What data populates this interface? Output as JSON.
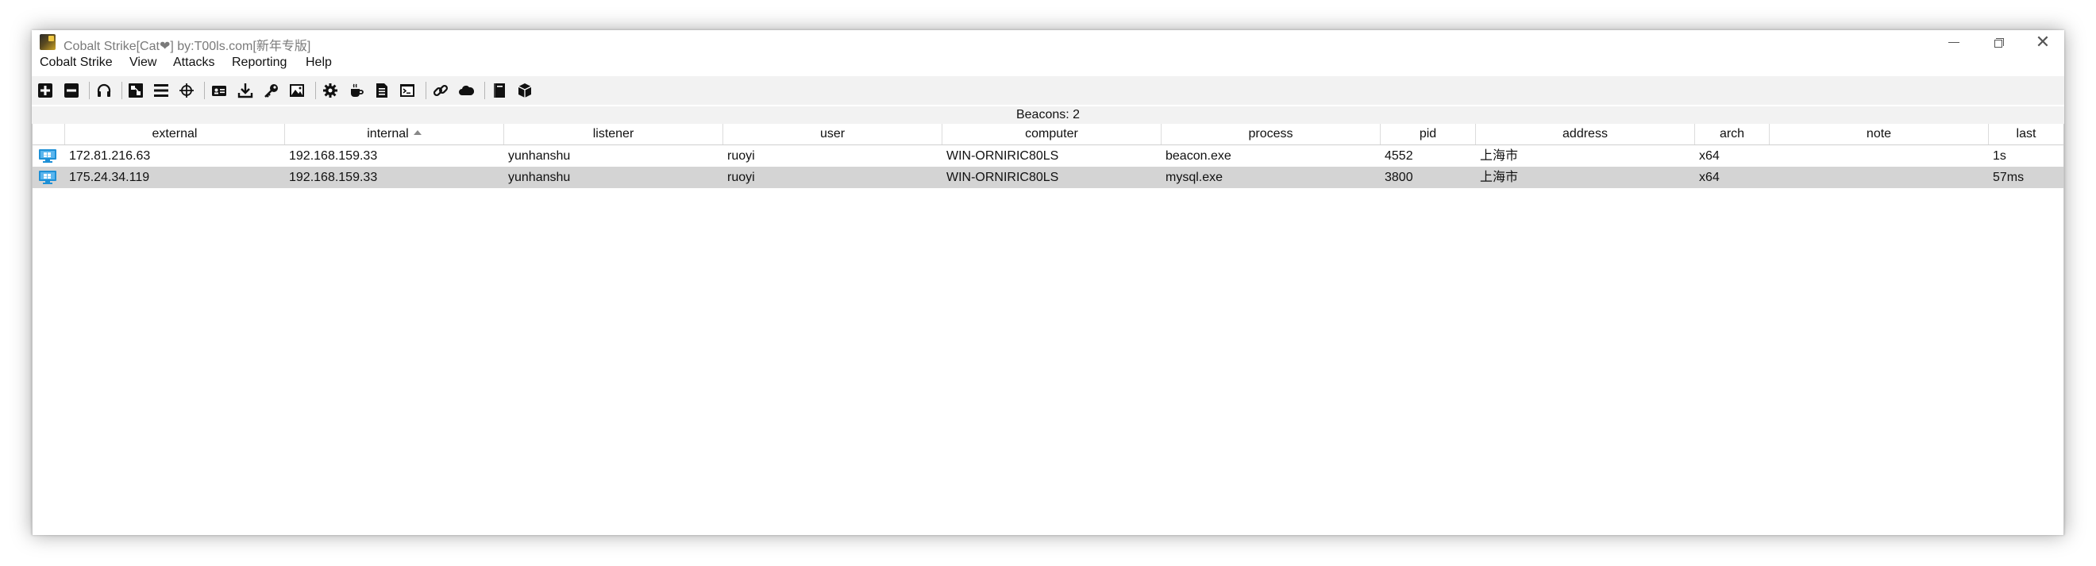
{
  "window": {
    "title": "Cobalt Strike[Cat❤] by:T00ls.com[新年专版]"
  },
  "menu": {
    "items": [
      "Cobalt Strike",
      "View",
      "Attacks",
      "Reporting",
      "Help"
    ]
  },
  "toolbar": {
    "icons": [
      "plus-icon",
      "minus-icon",
      "headphones-icon",
      "pivot-graph-icon",
      "list-icon",
      "crosshair-icon",
      "credential-card-icon",
      "download-icon",
      "key-icon",
      "image-icon",
      "gear-icon",
      "coffee-icon",
      "document-icon",
      "terminal-icon",
      "link-icon",
      "cloud-icon",
      "book-icon",
      "package-icon"
    ]
  },
  "beacons_label": "Beacons: 2",
  "table": {
    "columns": [
      "",
      "external",
      "internal",
      "listener",
      "user",
      "computer",
      "process",
      "pid",
      "address",
      "arch",
      "note",
      "last"
    ],
    "sorted_column": "internal",
    "sort_direction": "ascending",
    "rows": [
      {
        "external": "172.81.216.63",
        "internal": "192.168.159.33",
        "listener": "yunhanshu",
        "user": "ruoyi",
        "computer": "WIN-ORNIRIC80LS",
        "process": "beacon.exe",
        "pid": "4552",
        "address": "上海市",
        "arch": "x64",
        "note": "",
        "last": "1s",
        "selected": false
      },
      {
        "external": "175.24.34.119",
        "internal": "192.168.159.33",
        "listener": "yunhanshu",
        "user": "ruoyi",
        "computer": "WIN-ORNIRIC80LS",
        "process": "mysql.exe",
        "pid": "3800",
        "address": "上海市",
        "arch": "x64",
        "note": "",
        "last": "57ms",
        "selected": true
      }
    ]
  },
  "colors": {
    "selected_row": "#d4d4d4",
    "toolbar_bg": "#f2f2f2",
    "beacon_icon": "#1e90d6"
  }
}
